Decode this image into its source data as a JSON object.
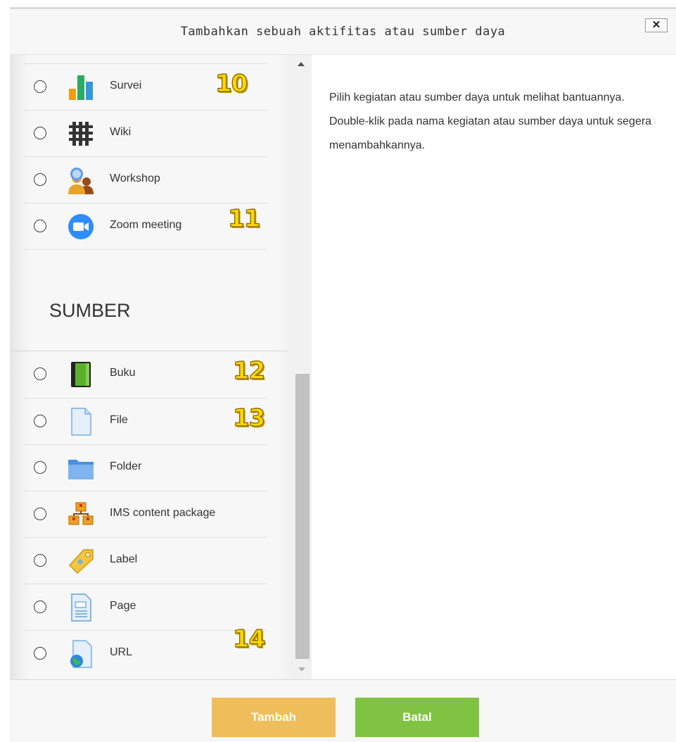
{
  "dialog": {
    "title": "Tambahkan sebuah aktifitas atau sumber daya",
    "close_label": "✕"
  },
  "activities": [
    {
      "label": "Survei",
      "icon": "survey-icon",
      "annotation": "10"
    },
    {
      "label": "Wiki",
      "icon": "wiki-icon",
      "annotation": ""
    },
    {
      "label": "Workshop",
      "icon": "workshop-icon",
      "annotation": ""
    },
    {
      "label": "Zoom meeting",
      "icon": "zoom-icon",
      "annotation": "11"
    }
  ],
  "resources_heading": "SUMBER",
  "resources": [
    {
      "label": "Buku",
      "icon": "book-icon",
      "annotation": "12"
    },
    {
      "label": "File",
      "icon": "file-icon",
      "annotation": "13"
    },
    {
      "label": "Folder",
      "icon": "folder-icon",
      "annotation": ""
    },
    {
      "label": "IMS content package",
      "icon": "ims-package-icon",
      "annotation": ""
    },
    {
      "label": "Label",
      "icon": "label-icon",
      "annotation": ""
    },
    {
      "label": "Page",
      "icon": "page-icon",
      "annotation": ""
    },
    {
      "label": "URL",
      "icon": "url-icon",
      "annotation": "14"
    }
  ],
  "help_text": "Pilih kegiatan atau sumber daya untuk melihat bantuannya. Double-klik pada nama kegiatan atau sumber daya untuk segera menambahkannya.",
  "buttons": {
    "add_label": "Tambah",
    "cancel_label": "Batal"
  },
  "colors": {
    "add_button": "#f0bd5b",
    "cancel_button": "#80c342",
    "annotation": "#ffd800"
  }
}
